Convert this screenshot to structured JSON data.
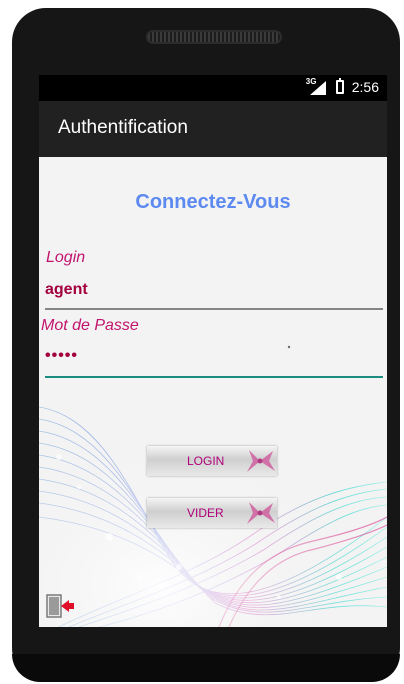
{
  "status_bar": {
    "network_label": "3G",
    "time": "2:56"
  },
  "app_bar": {
    "title": "Authentification"
  },
  "form": {
    "heading": "Connectez-Vous",
    "login_label": "Login",
    "login_value": "agent",
    "password_label": "Mot de Passe",
    "password_value": "•••••"
  },
  "buttons": {
    "login_label": "LOGIN",
    "clear_label": "VIDER"
  },
  "icons": {
    "exit": "exit-door-icon",
    "signal": "signal-icon",
    "battery": "battery-icon"
  },
  "colors": {
    "heading": "#5d8af1",
    "label": "#c2146d",
    "value": "#a3003e",
    "appbar": "#212121",
    "accent_underline": "#1b8c7f"
  }
}
